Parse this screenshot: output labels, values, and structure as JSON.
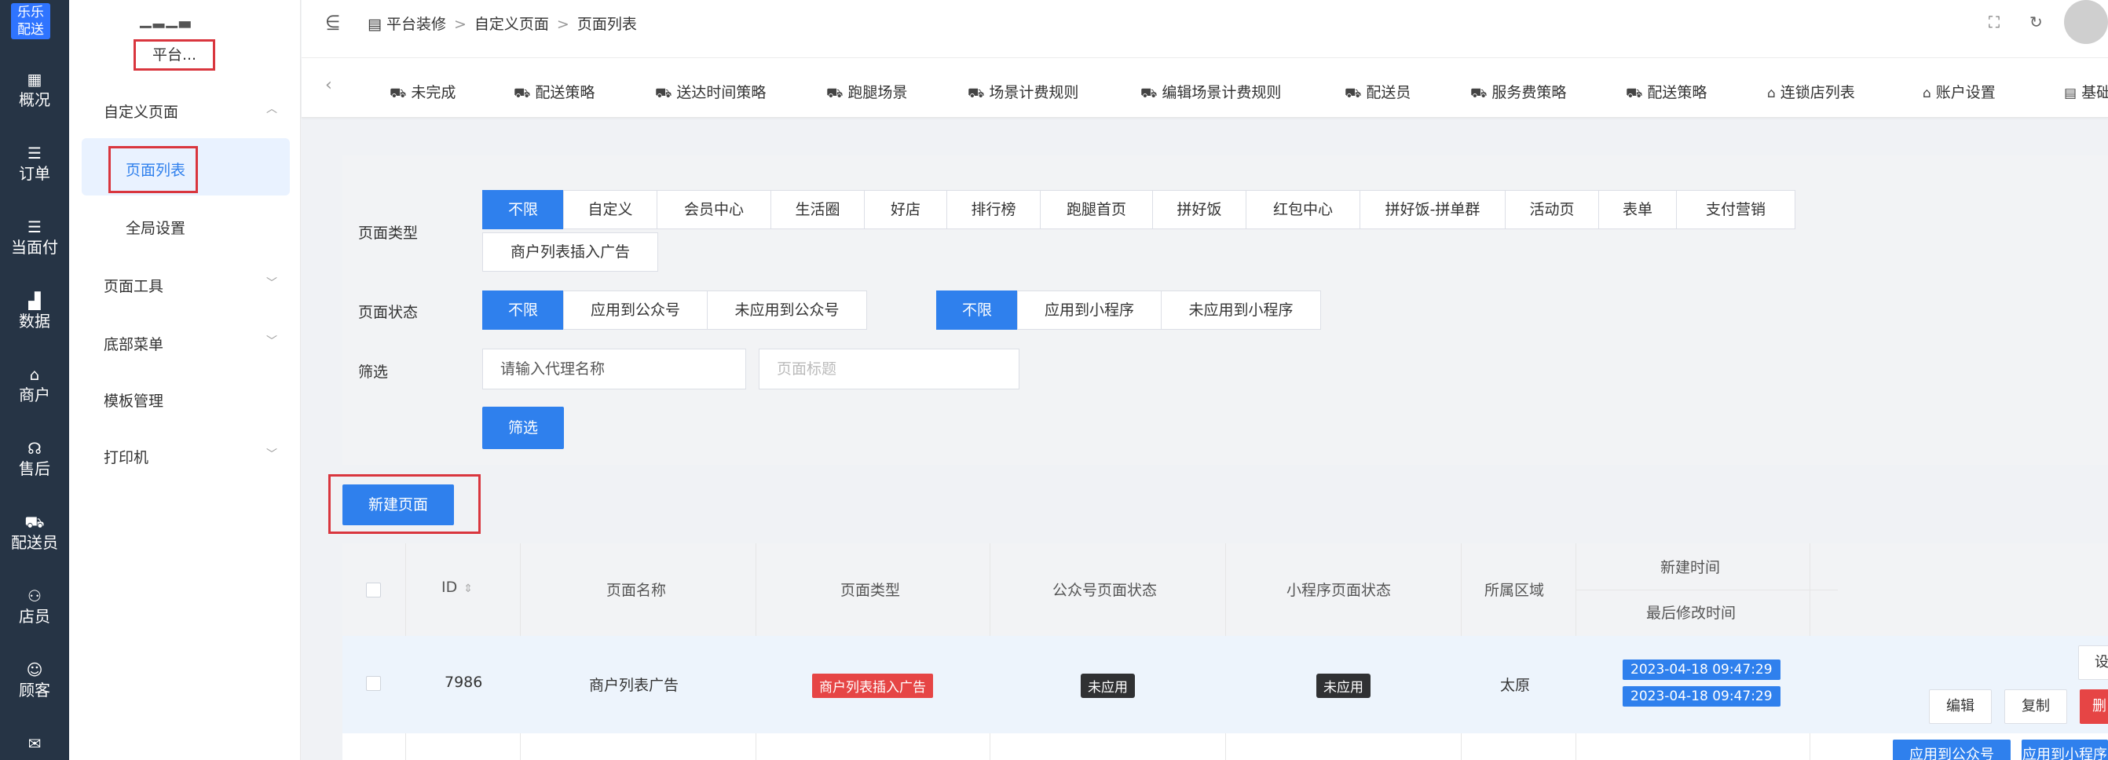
{
  "rail": {
    "logo": "乐乐\n配送",
    "logo_line1": "乐乐",
    "logo_line2": "配送",
    "items": [
      {
        "label": "概况",
        "icon": "grid-icon"
      },
      {
        "label": "订单",
        "icon": "list-icon"
      },
      {
        "label": "当面付",
        "icon": "list-icon"
      },
      {
        "label": "数据",
        "icon": "bar-chart-icon"
      },
      {
        "label": "商户",
        "icon": "shop-icon"
      },
      {
        "label": "售后",
        "icon": "headset-icon"
      },
      {
        "label": "配送员",
        "icon": "scooter-icon"
      },
      {
        "label": "店员",
        "icon": "users-icon"
      },
      {
        "label": "顾客",
        "icon": "user-circle-icon"
      }
    ]
  },
  "sidebar": {
    "user_name": "▁▂▁▃",
    "platform": "平台...",
    "menu": [
      {
        "label": "自定义页面",
        "chevron": "up"
      },
      {
        "label": "页面列表"
      },
      {
        "label": "全局设置"
      },
      {
        "label": "页面工具",
        "chevron": "down"
      },
      {
        "label": "底部菜单",
        "chevron": "down"
      },
      {
        "label": "模板管理"
      },
      {
        "label": "打印机",
        "chevron": "down"
      }
    ]
  },
  "header": {
    "breadcrumb": [
      "平台装修",
      "自定义页面",
      "页面列表"
    ]
  },
  "tabs": [
    "未完成",
    "配送策略",
    "送达时间策略",
    "跑腿场景",
    "场景计费规则",
    "编辑场景计费规则",
    "配送员",
    "服务费策略",
    "配送策略",
    "连锁店列表",
    "账户设置",
    "基础"
  ],
  "filters": {
    "page_type_label": "页面类型",
    "page_types": [
      "不限",
      "自定义",
      "会员中心",
      "生活圈",
      "好店",
      "排行榜",
      "跑腿首页",
      "拼好饭",
      "红包中心",
      "拼好饭-拼单群",
      "活动页",
      "表单",
      "支付营销",
      "商户列表插入广告"
    ],
    "page_status_label": "页面状态",
    "gzh_status": [
      "不限",
      "应用到公众号",
      "未应用到公众号"
    ],
    "mini_status": [
      "不限",
      "应用到小程序",
      "未应用到小程序"
    ],
    "filter_label": "筛选",
    "agent_placeholder": "请输入代理名称",
    "title_placeholder": "页面标题",
    "filter_button": "筛选"
  },
  "new_page_button": "新建页面",
  "table": {
    "headers": {
      "id": "ID",
      "name": "页面名称",
      "type": "页面类型",
      "gzh": "公众号页面状态",
      "mini": "小程序页面状态",
      "region": "所属区域",
      "created": "新建时间",
      "modified": "最后修改时间"
    },
    "rows": [
      {
        "id": "7986",
        "name": "商户列表广告",
        "type": "商户列表插入广告",
        "gzh": "未应用",
        "mini": "未应用",
        "region": "太原",
        "created": "2023-04-18 09:47:29",
        "modified": "2023-04-18 09:47:29",
        "actions": [
          "设",
          "编辑",
          "复制",
          "删"
        ]
      }
    ],
    "row2_actions": [
      "应用到公众号",
      "应用到小程序"
    ]
  },
  "colors": {
    "primary": "#2f80ed",
    "danger": "#e64545",
    "rail_bg": "#263445"
  }
}
